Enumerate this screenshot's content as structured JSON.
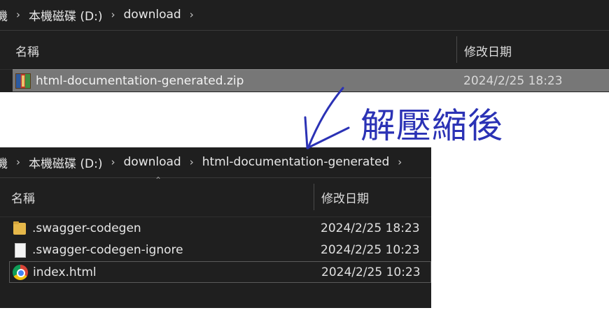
{
  "window_top": {
    "breadcrumb": {
      "edge": "機",
      "items": [
        "本機磁碟 (D:)",
        "download"
      ]
    },
    "columns": {
      "name": "名稱",
      "date_modified": "修改日期"
    },
    "rows": [
      {
        "name": "html-documentation-generated.zip",
        "date": "2024/2/25 18:23",
        "icon": "winrar-archive-icon"
      }
    ]
  },
  "annotation": {
    "text": "解壓縮後",
    "color": "#2b32b5"
  },
  "window_bottom": {
    "breadcrumb": {
      "edge": "機",
      "items": [
        "本機磁碟 (D:)",
        "download",
        "html-documentation-generated"
      ]
    },
    "columns": {
      "name": "名稱",
      "date_modified": "修改日期"
    },
    "rows": [
      {
        "name": ".swagger-codegen",
        "date": "2024/2/25 18:23",
        "icon": "folder-icon"
      },
      {
        "name": ".swagger-codegen-ignore",
        "date": "2024/2/25 10:23",
        "icon": "file-icon"
      },
      {
        "name": "index.html",
        "date": "2024/2/25 10:23",
        "icon": "chrome-icon"
      }
    ]
  },
  "colors": {
    "explorer_bg": "#1f1f1f",
    "selection": "#777777",
    "annotation": "#2b32b5"
  }
}
